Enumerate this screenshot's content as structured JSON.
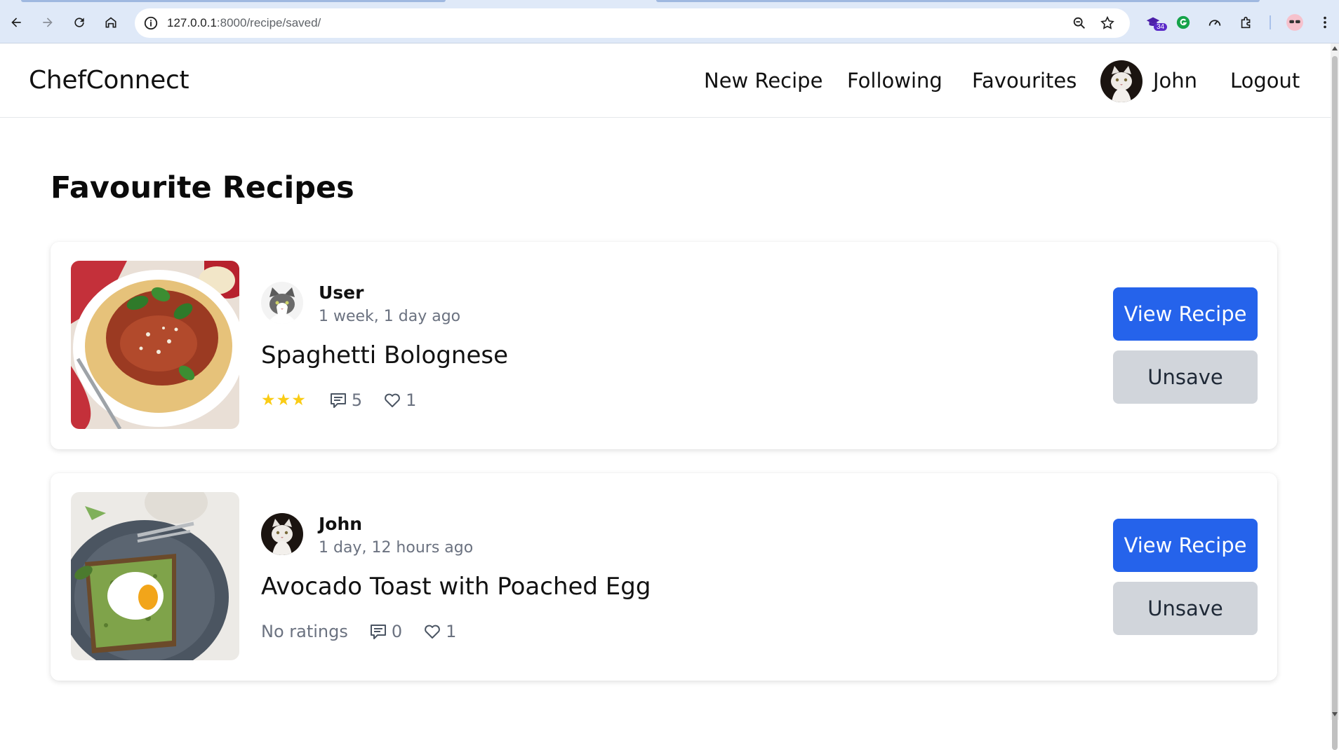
{
  "browser": {
    "url_host": "127.0.0.1",
    "url_path": ":8000/recipe/saved/",
    "extension_badge": "34"
  },
  "header": {
    "brand": "ChefConnect",
    "nav": {
      "new_recipe": "New Recipe",
      "following": "Following",
      "favourites": "Favourites",
      "user": "John",
      "logout": "Logout"
    }
  },
  "main": {
    "title": "Favourite Recipes",
    "recipes": [
      {
        "author": "User",
        "time": "1 week, 1 day ago",
        "title": "Spaghetti Bolognese",
        "rating_display": "★★★",
        "rating_stars": 3,
        "comments": "5",
        "likes": "1",
        "view_label": "View Recipe",
        "unsave_label": "Unsave"
      },
      {
        "author": "John",
        "time": "1 day, 12 hours ago",
        "title": "Avocado Toast with Poached Egg",
        "rating_display": "No ratings",
        "comments": "0",
        "likes": "1",
        "view_label": "View Recipe",
        "unsave_label": "Unsave"
      }
    ]
  },
  "colors": {
    "primary": "#2563eb",
    "secondary": "#d1d5db",
    "star": "#facc15",
    "muted": "#6b7280"
  }
}
